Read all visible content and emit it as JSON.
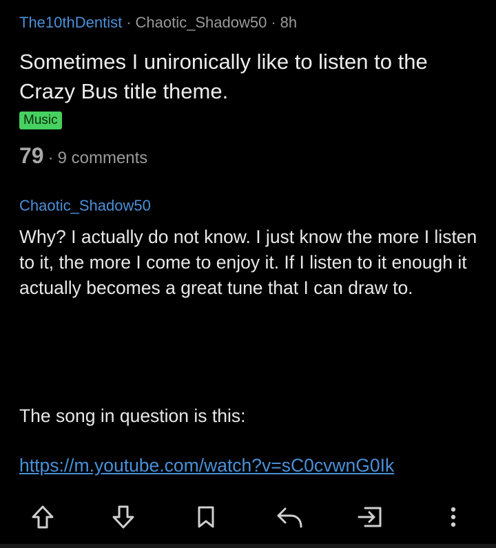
{
  "post": {
    "subreddit": "The10thDentist",
    "separator": "·",
    "author": "Chaotic_Shadow50",
    "age": "8h",
    "title": "Sometimes I unironically like to listen to the Crazy Bus title theme.",
    "flair": "Music",
    "score": "79",
    "comments": "9 comments",
    "body_author": "Chaotic_Shadow50",
    "body_paragraph_1": "Why? I actually do not know. I just know the more I listen to it, the more I come to enjoy it. If I listen to it enough it actually becomes a great tune that I can draw to.",
    "body_paragraph_2": "The song in question is this:",
    "link": "https://m.youtube.com/watch?v=sC0cvwnG0Ik"
  },
  "actions": [
    {
      "name": "upvote",
      "icon": "arrow-up-icon"
    },
    {
      "name": "downvote",
      "icon": "arrow-down-icon"
    },
    {
      "name": "save",
      "icon": "bookmark-icon"
    },
    {
      "name": "reply",
      "icon": "reply-icon"
    },
    {
      "name": "share",
      "icon": "share-icon"
    },
    {
      "name": "more",
      "icon": "more-vertical-icon"
    }
  ],
  "colors": {
    "background": "#000000",
    "link": "#4a90d9",
    "flair_bg": "#46d160",
    "text": "#e8e8e8",
    "muted": "#9a9a9a"
  }
}
